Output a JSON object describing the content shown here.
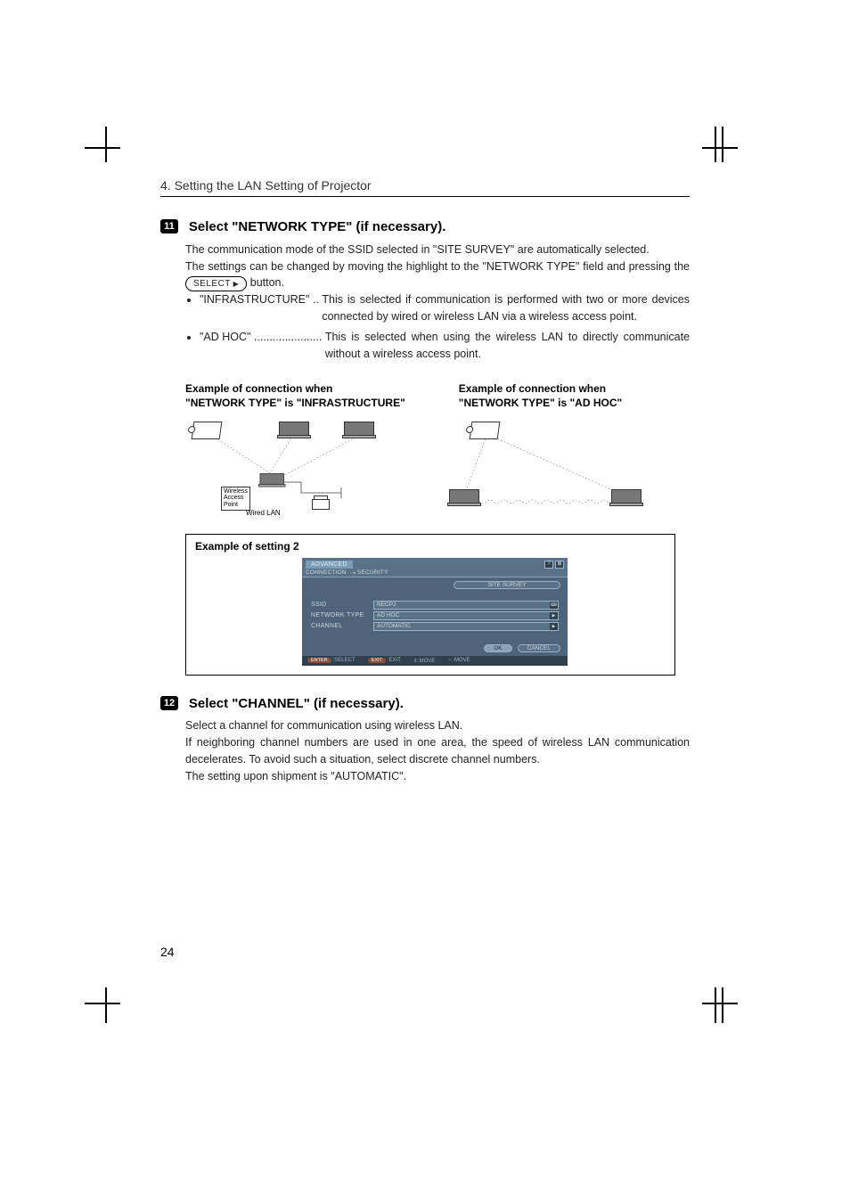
{
  "header": "4. Setting the LAN Setting of Projector",
  "step11": {
    "number": "11",
    "title": "Select \"NETWORK TYPE\" (if necessary).",
    "p1": "The communication mode of the SSID selected in \"SITE SURVEY\" are automatically selected.",
    "p2a": "The settings can be changed by moving the highlight to the \"NETWORK TYPE\" field and pressing the ",
    "select_label": "SELECT",
    "p2b": " button.",
    "bullet1_label": "\"INFRASTRUCTURE\" ..",
    "bullet1_text": "This is selected if communication is performed with two or more devices connected by wired or wireless LAN via a wireless access point.",
    "bullet2_label": "\"AD HOC\" ......................",
    "bullet2_text": "This is selected when using the wireless LAN to directly communicate without a wireless access point."
  },
  "example_infra_title_l1": "Example of connection when",
  "example_infra_title_l2": "\"NETWORK TYPE\" is \"INFRASTRUCTURE\"",
  "example_adhoc_title_l1": "Example of connection when",
  "example_adhoc_title_l2": "\"NETWORK TYPE\" is \"AD HOC\"",
  "diagram_infra": {
    "wap_label_l1": "Wireless",
    "wap_label_l2": "Access",
    "wap_label_l3": "Point",
    "wired_lan_label": "Wired LAN"
  },
  "settings2": {
    "title": "Example of setting 2",
    "tab_advanced": "ADVANCED",
    "subtab_connection": "CONNECTION",
    "subtab_security": "SECURITY",
    "site_survey_btn": "SITE SURVEY",
    "ssid_label": "SSID",
    "ssid_value": "NECPJ",
    "network_type_label": "NETWORK TYPE",
    "network_type_value": "AD HOC",
    "channel_label": "CHANNEL",
    "channel_value": "AUTOMATIC",
    "ok_btn": "OK",
    "cancel_btn": "CANCEL",
    "hint_enter": "ENTER",
    "hint_select": ":SELECT",
    "hint_exit_btn": "EXIT",
    "hint_exit": ":EXIT",
    "hint_updown": "⇕:MOVE",
    "hint_leftright": "⇔:MOVE"
  },
  "step12": {
    "number": "12",
    "title": "Select \"CHANNEL\" (if necessary).",
    "p1": "Select a channel for communication using wireless LAN.",
    "p2": "If neighboring channel numbers are used in one area, the speed of wireless LAN communication decelerates.  To avoid such a situation, select discrete channel numbers.",
    "p3": "The setting upon shipment is \"AUTOMATIC\"."
  },
  "page_number": "24"
}
